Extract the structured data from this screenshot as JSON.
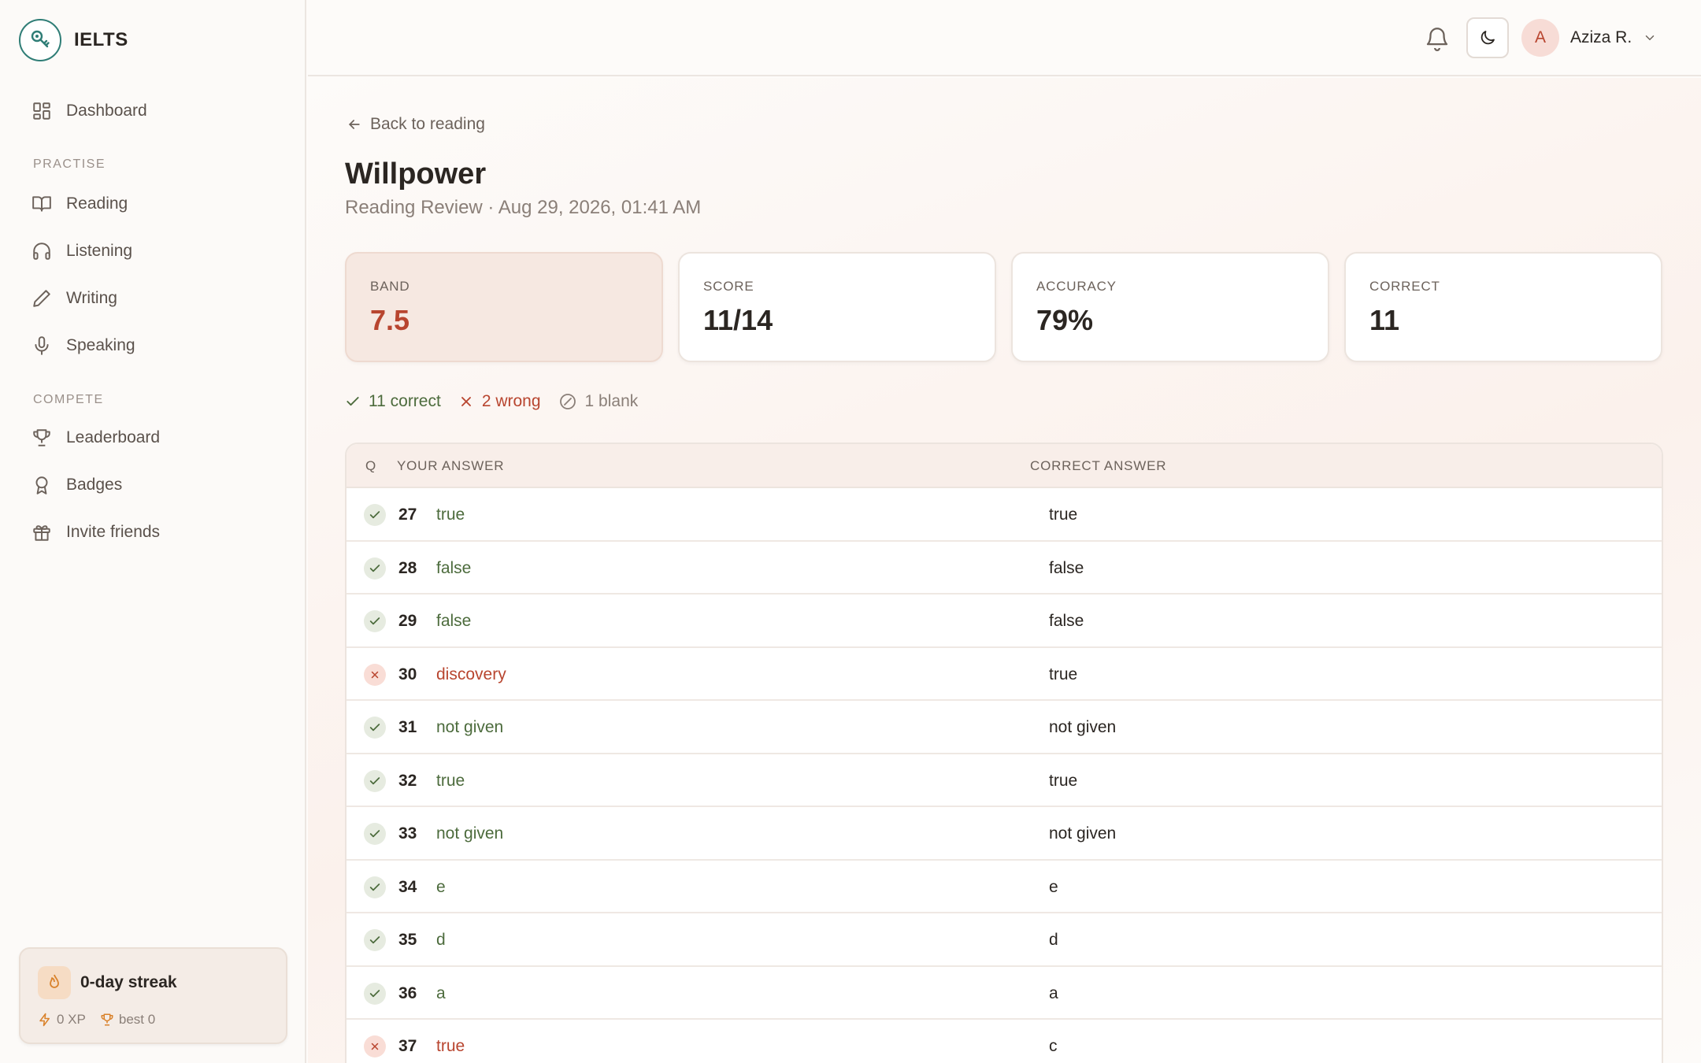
{
  "brand": {
    "name": "IELTS"
  },
  "sidebar": {
    "dashboard": "Dashboard",
    "practise_label": "PRACTISE",
    "practise": [
      "Reading",
      "Listening",
      "Writing",
      "Speaking"
    ],
    "compete_label": "COMPETE",
    "compete": [
      "Leaderboard",
      "Badges",
      "Invite friends"
    ],
    "streak": {
      "title": "0-day streak",
      "xp": "0 XP",
      "best": "best 0"
    }
  },
  "topbar": {
    "user_initial": "A",
    "user_name": "Aziza R."
  },
  "page": {
    "back_label": "Back to reading",
    "title": "Willpower",
    "subtitle": "Reading Review · Aug 29, 2026, 01:41 AM"
  },
  "stats": [
    {
      "label": "BAND",
      "value": "7.5"
    },
    {
      "label": "SCORE",
      "value": "11/14"
    },
    {
      "label": "ACCURACY",
      "value": "79%"
    },
    {
      "label": "CORRECT",
      "value": "11"
    }
  ],
  "summary": {
    "correct": "11 correct",
    "wrong": "2 wrong",
    "blank": "1 blank"
  },
  "table": {
    "headers": {
      "q": "Q",
      "your_answer": "YOUR ANSWER",
      "correct_answer": "CORRECT ANSWER"
    },
    "rows": [
      {
        "q": "27",
        "your": "true",
        "correct": "true",
        "status": "correct"
      },
      {
        "q": "28",
        "your": "false",
        "correct": "false",
        "status": "correct"
      },
      {
        "q": "29",
        "your": "false",
        "correct": "false",
        "status": "correct"
      },
      {
        "q": "30",
        "your": "discovery",
        "correct": "true",
        "status": "wrong"
      },
      {
        "q": "31",
        "your": "not given",
        "correct": "not given",
        "status": "correct"
      },
      {
        "q": "32",
        "your": "true",
        "correct": "true",
        "status": "correct"
      },
      {
        "q": "33",
        "your": "not given",
        "correct": "not given",
        "status": "correct"
      },
      {
        "q": "34",
        "your": "e",
        "correct": "e",
        "status": "correct"
      },
      {
        "q": "35",
        "your": "d",
        "correct": "d",
        "status": "correct"
      },
      {
        "q": "36",
        "your": "a",
        "correct": "a",
        "status": "correct"
      },
      {
        "q": "37",
        "your": "true",
        "correct": "c",
        "status": "wrong"
      }
    ]
  },
  "colors": {
    "accent": "#b8452f",
    "correct": "#4c6b3c",
    "brand": "#2f7d76"
  }
}
